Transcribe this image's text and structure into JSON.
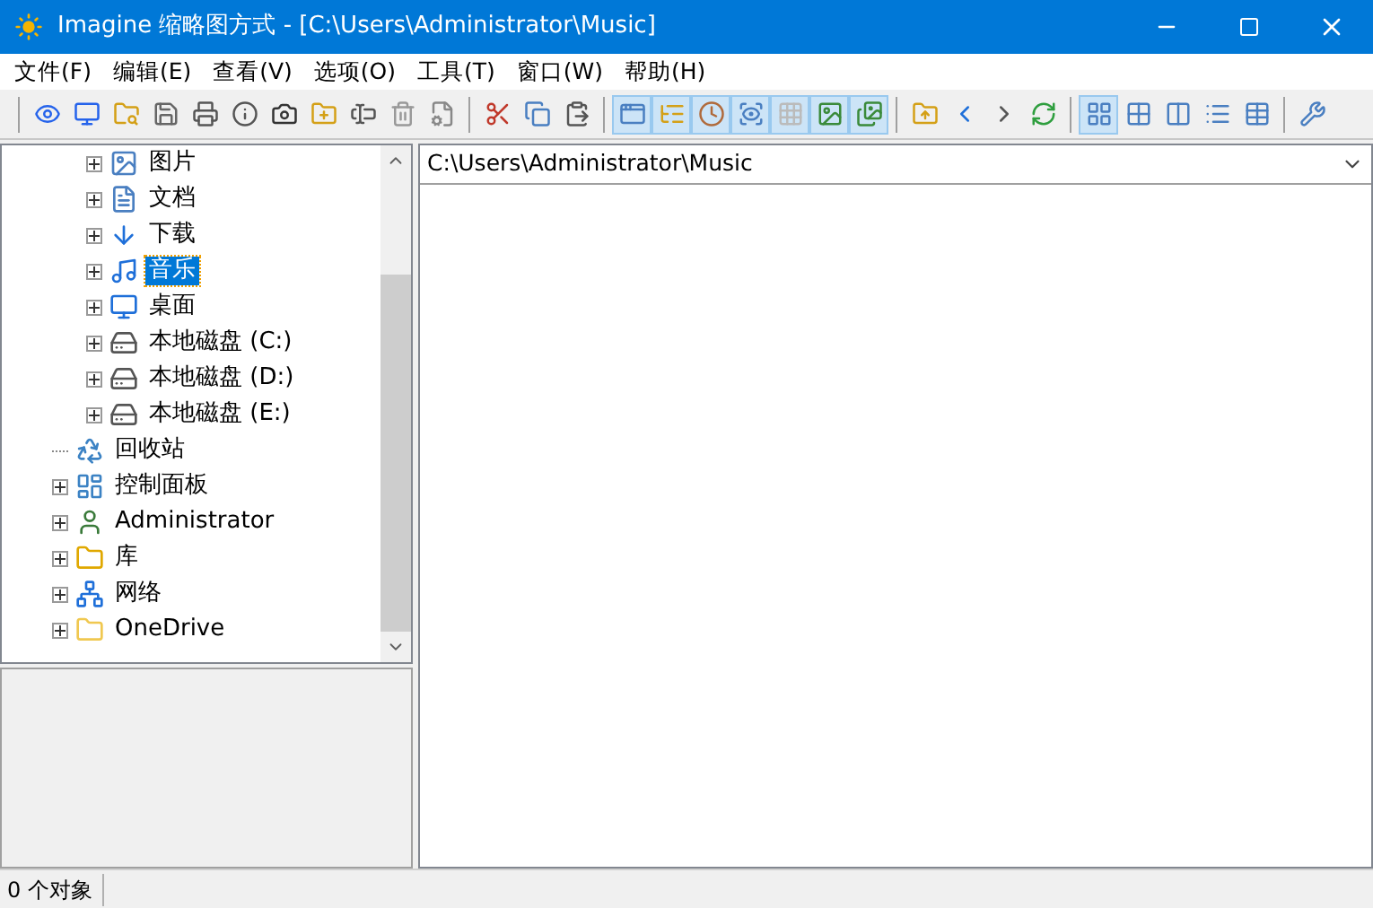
{
  "window": {
    "title": "Imagine 缩略图方式 - [C:\\Users\\Administrator\\Music]"
  },
  "menu": [
    "文件(F)",
    "编辑(E)",
    "查看(V)",
    "选项(O)",
    "工具(T)",
    "窗口(W)",
    "帮助(H)"
  ],
  "toolbar": [
    [
      {
        "pressed": false
      },
      {
        "pressed": false
      },
      {
        "pressed": false
      },
      {
        "pressed": false
      },
      {
        "pressed": false
      },
      {
        "pressed": false
      },
      {
        "pressed": false
      },
      {
        "pressed": false
      },
      {
        "pressed": false
      },
      {
        "pressed": false
      },
      {
        "pressed": false
      }
    ],
    [
      {
        "pressed": false
      },
      {
        "pressed": false
      },
      {
        "pressed": false
      }
    ],
    [
      {
        "pressed": true
      },
      {
        "pressed": true
      },
      {
        "pressed": true
      },
      {
        "pressed": true
      },
      {
        "pressed": true
      },
      {
        "pressed": true
      },
      {
        "pressed": true
      }
    ],
    [
      {
        "pressed": false
      },
      {
        "pressed": false
      },
      {
        "pressed": false
      },
      {
        "pressed": false
      }
    ],
    [
      {
        "pressed": true
      },
      {
        "pressed": false
      },
      {
        "pressed": false
      },
      {
        "pressed": false
      },
      {
        "pressed": false
      }
    ],
    [
      {
        "pressed": false
      }
    ]
  ],
  "tree": [
    {
      "children": [
        {
          "label": "图片",
          "expandable": true,
          "selected": false
        },
        {
          "label": "文档",
          "expandable": true,
          "selected": false
        },
        {
          "label": "下载",
          "expandable": true,
          "selected": false
        },
        {
          "label": "音乐",
          "expandable": true,
          "selected": true
        },
        {
          "label": "桌面",
          "expandable": true,
          "selected": false
        },
        {
          "label": "本地磁盘 (C:)",
          "expandable": true,
          "selected": false
        },
        {
          "label": "本地磁盘 (D:)",
          "expandable": true,
          "selected": false
        },
        {
          "label": "本地磁盘 (E:)",
          "expandable": true,
          "selected": false
        }
      ]
    },
    {
      "label": "回收站",
      "expandable": false,
      "selected": false
    },
    {
      "label": "控制面板",
      "expandable": true,
      "selected": false
    },
    {
      "label": "Administrator",
      "expandable": true,
      "selected": false
    },
    {
      "label": "库",
      "expandable": true,
      "selected": false
    },
    {
      "label": "网络",
      "expandable": true,
      "selected": false
    },
    {
      "label": "OneDrive",
      "expandable": true,
      "selected": false
    }
  ],
  "address": {
    "value": "C:\\Users\\Administrator\\Music"
  },
  "status_bar": "0 个对象"
}
